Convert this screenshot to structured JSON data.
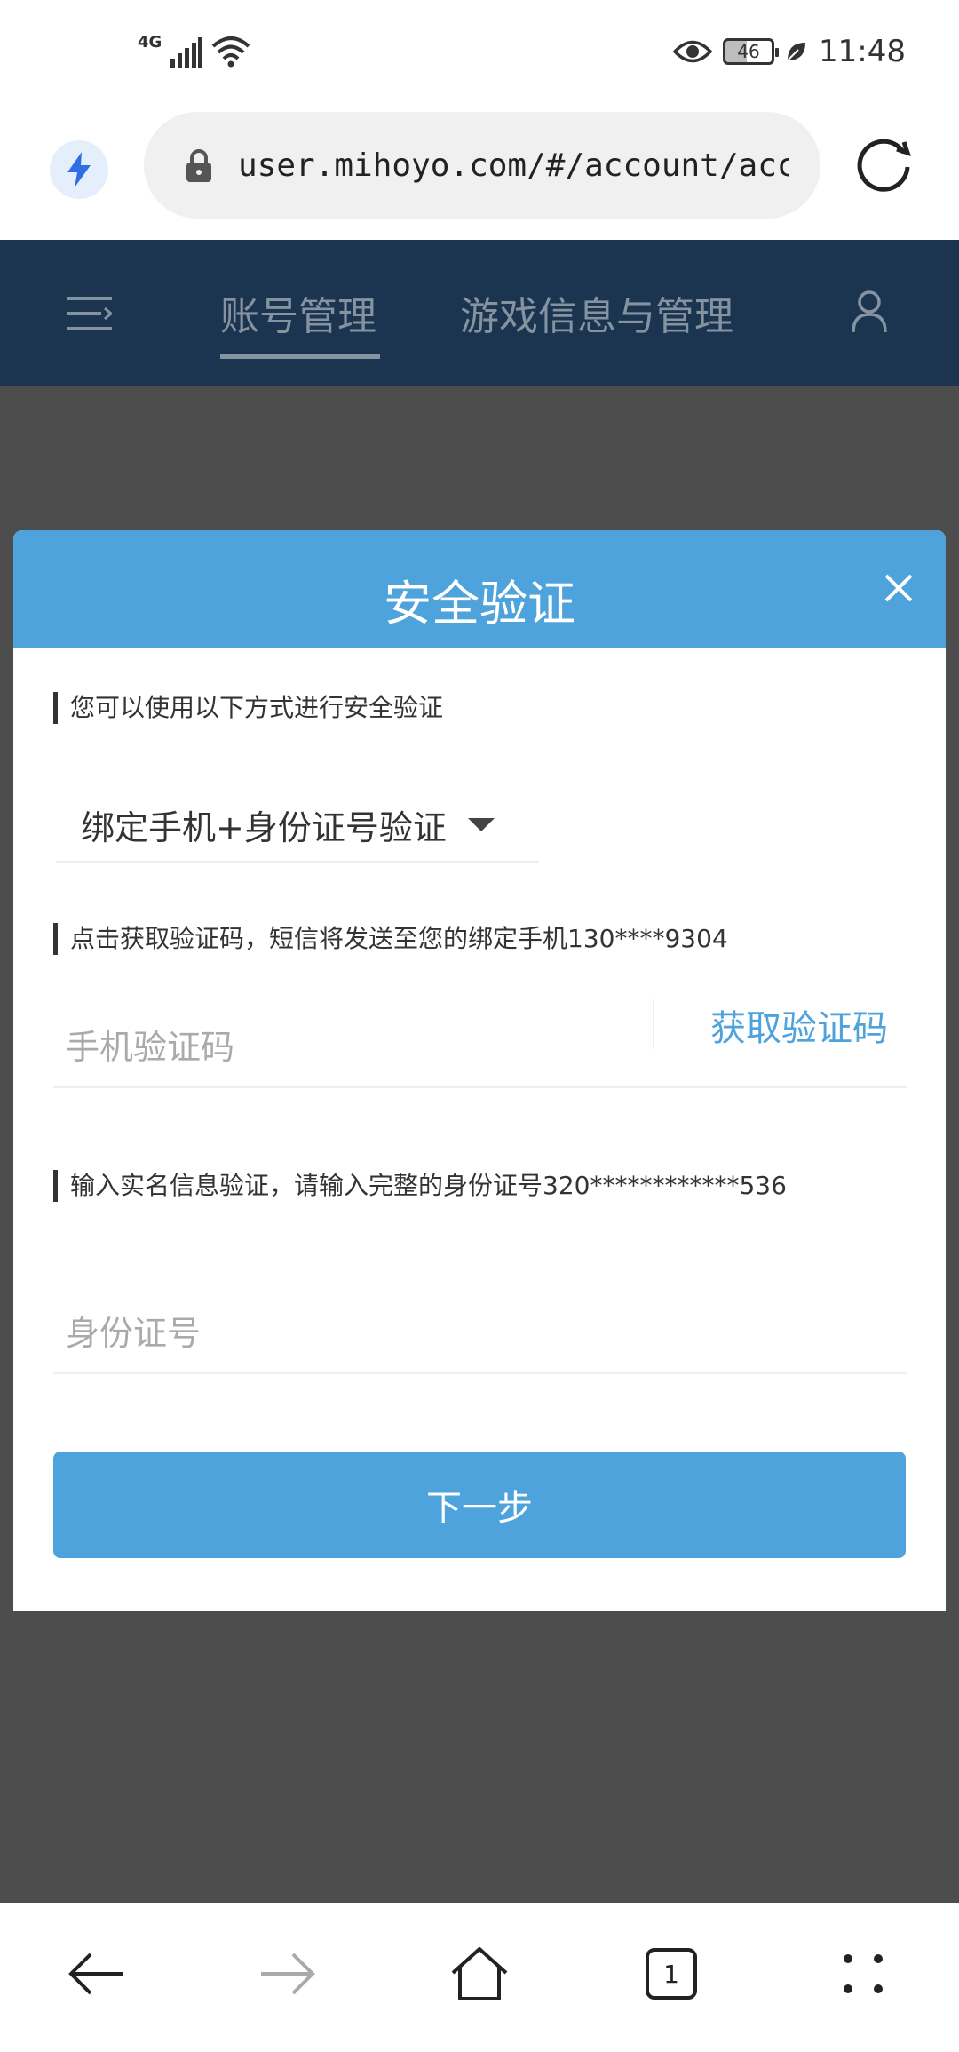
{
  "status_bar": {
    "network": "4G",
    "battery": "46",
    "time": "11:48"
  },
  "browser": {
    "url": "user.mihoyo.com/#/account/account"
  },
  "site_nav": {
    "tabs": [
      {
        "label": "账号管理",
        "active": true
      },
      {
        "label": "游戏信息与管理",
        "active": false
      }
    ]
  },
  "modal": {
    "title": "安全验证",
    "intro": "您可以使用以下方式进行安全验证",
    "method": "绑定手机+身份证号验证",
    "sms_hint": "点击获取验证码，短信将发送至您的绑定手机130****9304",
    "code_placeholder": "手机验证码",
    "code_value": "",
    "get_code_label": "获取验证码",
    "id_hint": "输入实名信息验证，请输入完整的身份证号320************536",
    "id_placeholder": "身份证号",
    "id_value": "",
    "next_label": "下一步"
  },
  "bottom_nav": {
    "tab_count": "1"
  },
  "colors": {
    "accent": "#4ea3dc",
    "nav_bg": "#1b3450",
    "overlay": "#4d4d4d"
  }
}
